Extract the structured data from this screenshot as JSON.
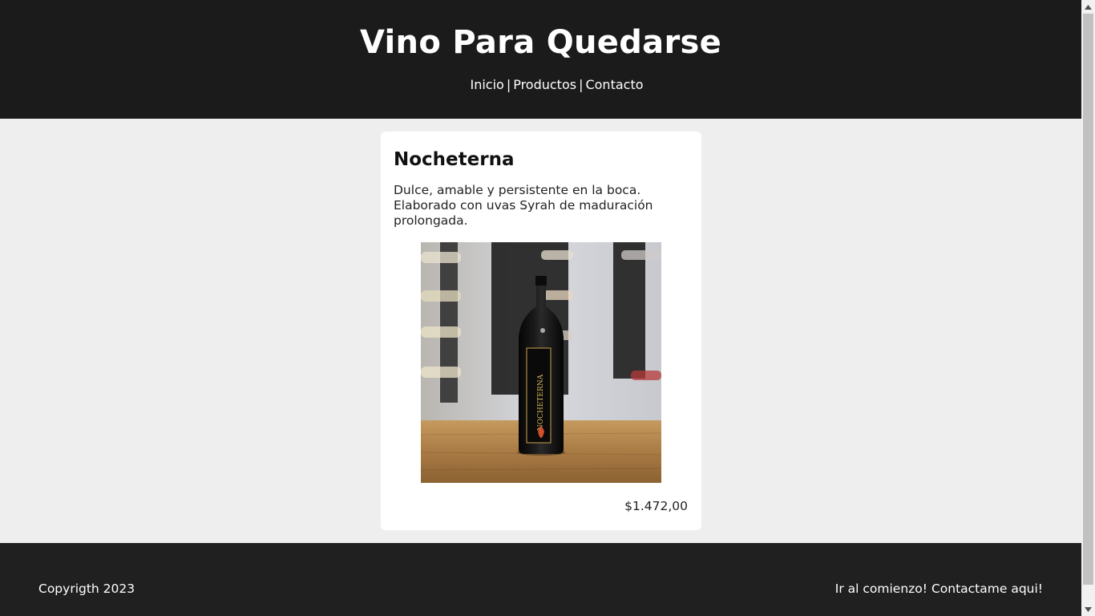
{
  "header": {
    "title": "Vino Para Quedarse",
    "nav": [
      {
        "label": "Inicio"
      },
      {
        "label": "Productos"
      },
      {
        "label": "Contacto"
      }
    ],
    "separator": "|"
  },
  "product": {
    "name": "Nocheterna",
    "description": "Dulce, amable y persistente en la boca. Elaborado con uvas Syrah de maduración prolongada.",
    "image_label": "NOCHETERNA",
    "price": "$1.472,00"
  },
  "footer": {
    "copyright": "Copyrigth 2023",
    "link_top": "Ir al comienzo!",
    "link_contact": "Contactame aqui!"
  },
  "colors": {
    "header_bg": "#1b1b1b",
    "page_bg": "#eeeeee",
    "card_bg": "#ffffff",
    "footer_bg": "#202020"
  }
}
